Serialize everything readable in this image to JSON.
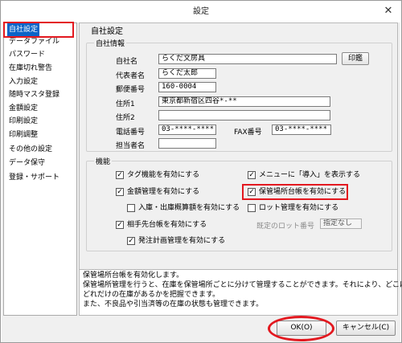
{
  "window": {
    "title": "設定",
    "close_glyph": "✕"
  },
  "sidebar": {
    "items": [
      {
        "label": "自社設定",
        "selected": true
      },
      {
        "label": "データファイル"
      },
      {
        "label": "パスワード"
      },
      {
        "label": "在庫切れ警告"
      },
      {
        "label": "入力設定"
      },
      {
        "label": "随時マスタ登録"
      },
      {
        "label": "金額設定"
      },
      {
        "label": "印刷設定"
      },
      {
        "label": "印刷調整"
      },
      {
        "label": "その他の設定"
      },
      {
        "label": "データ保守"
      },
      {
        "label": "登録・サポート"
      }
    ]
  },
  "panel": {
    "title": "自社設定"
  },
  "company_info": {
    "group_label": "自社情報",
    "fields": {
      "company_name": {
        "label": "自社名",
        "value": "らくだ文房具"
      },
      "representative": {
        "label": "代表者名",
        "value": "らくだ太郎"
      },
      "postal_code": {
        "label": "郵便番号",
        "value": "160-0004"
      },
      "address1": {
        "label": "住所1",
        "value": "東京都新宿区四谷*-**"
      },
      "address2": {
        "label": "住所2",
        "value": ""
      },
      "phone": {
        "label": "電話番号",
        "value": "03-****-****"
      },
      "fax": {
        "label": "FAX番号",
        "value": "03-****-****"
      },
      "contact": {
        "label": "担当者名",
        "value": ""
      }
    },
    "seal_button": "印鑑"
  },
  "features": {
    "group_label": "機能",
    "checkboxes": {
      "tag": {
        "label": "タグ機能を有効にする",
        "checked": true
      },
      "menu_intro": {
        "label": "メニューに「導入」を表示する",
        "checked": true
      },
      "amount": {
        "label": "金額管理を有効にする",
        "checked": true
      },
      "storage_ledger": {
        "label": "保管場所台帳を有効にする",
        "checked": true
      },
      "in_out_estimate": {
        "label": "入庫・出庫概算額を有効にする",
        "checked": false
      },
      "lot": {
        "label": "ロット管理を有効にする",
        "checked": false
      },
      "partner_ledger": {
        "label": "相手先台帳を有効にする",
        "checked": true
      },
      "order_plan": {
        "label": "発注計画管理を有効にする",
        "checked": true
      }
    },
    "lot_number": {
      "label": "既定のロット番号",
      "value": "指定なし"
    }
  },
  "description": {
    "lines": [
      "保管場所台帳を有効化します。",
      "保管場所管理を行うと、在庫を保管場所ごとに分けて管理することができます。それにより、どこに",
      "どれだけの在庫があるかを把握できます。",
      "また、不良品や引当済等の在庫の状態も管理できます。"
    ]
  },
  "footer": {
    "ok_label": "OK(O)",
    "cancel_label": "キャンセル(C)"
  },
  "highlight": {
    "color": "#e3181f"
  },
  "accent": {
    "selection": "#0a64c8"
  }
}
